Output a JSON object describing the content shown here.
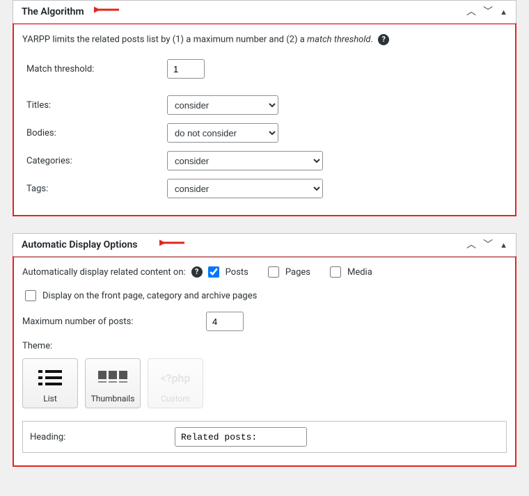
{
  "panel1": {
    "title": "The Algorithm",
    "intro_pre": "YARPP limits the related posts list by (1) a maximum number and (2) a ",
    "intro_em": "match threshold",
    "intro_post": ".",
    "rows": {
      "match_threshold_label": "Match threshold:",
      "match_threshold_value": "1",
      "titles_label": "Titles:",
      "titles_value": "consider",
      "bodies_label": "Bodies:",
      "bodies_value": "do not consider",
      "categories_label": "Categories:",
      "categories_value": "consider",
      "tags_label": "Tags:",
      "tags_value": "consider"
    }
  },
  "panel2": {
    "title": "Automatic Display Options",
    "auto_label": "Automatically display related content on:",
    "cb_posts": "Posts",
    "cb_pages": "Pages",
    "cb_media": "Media",
    "front_label": "Display on the front page, category and archive pages",
    "max_label": "Maximum number of posts:",
    "max_value": "4",
    "theme_label": "Theme:",
    "theme_list": "List",
    "theme_thumbs": "Thumbnails",
    "theme_custom": "Custom",
    "heading_label": "Heading:",
    "heading_value": "Related posts:"
  }
}
